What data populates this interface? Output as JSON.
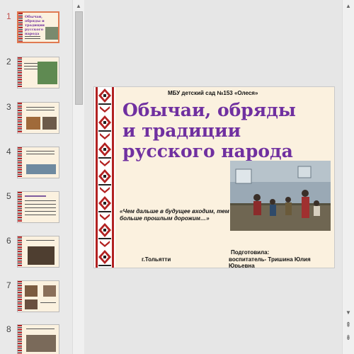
{
  "thumbnails": [
    {
      "number": "1",
      "active": true,
      "title": "Обычаи, обряды и традиции русского народа"
    },
    {
      "number": "2",
      "active": false
    },
    {
      "number": "3",
      "active": false
    },
    {
      "number": "4",
      "active": false
    },
    {
      "number": "5",
      "active": false
    },
    {
      "number": "6",
      "active": false
    },
    {
      "number": "7",
      "active": false
    },
    {
      "number": "8",
      "active": false
    }
  ],
  "slide": {
    "header": "МБУ детский сад №153 «Олеся»",
    "title": "Обычаи, обряды и традиции русского народа",
    "quote": "«Чем дальше в будущее входим, тем больше прошлым дорожим…»",
    "city": "г.Тольятти",
    "prepared_label": "Подготовила:",
    "prepared_name": "воспитатель- Тришина Юлия Юрьевна"
  },
  "icons": {
    "scroll_up": "▲",
    "scroll_down": "▼",
    "prev_slide": "⇞",
    "next_slide": "⇟"
  },
  "colors": {
    "title": "#7030a0",
    "active_thumb_border": "#e07a52",
    "ornament_red": "#b22222",
    "slide_bg": "#fbf1df"
  }
}
